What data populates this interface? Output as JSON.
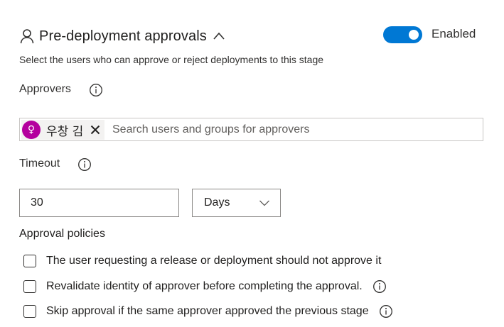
{
  "section": {
    "title": "Pre-deployment approvals",
    "toggle_label": "Enabled",
    "toggle_on": true,
    "description": "Select the users who can approve or reject deployments to this stage"
  },
  "approvers": {
    "label": "Approvers",
    "chips": [
      {
        "name": "우창 김",
        "avatar_glyph": "♀",
        "avatar_color": "#b4009e"
      }
    ],
    "placeholder": "Search users and groups for approvers"
  },
  "timeout": {
    "label": "Timeout",
    "value": "30",
    "unit": "Days"
  },
  "policies": {
    "title": "Approval policies",
    "items": [
      {
        "label": "The user requesting a release or deployment should not approve it",
        "checked": false,
        "has_info": false
      },
      {
        "label": "Revalidate identity of approver before completing the approval.",
        "checked": false,
        "has_info": true
      },
      {
        "label": "Skip approval if the same approver approved the previous stage",
        "checked": false,
        "has_info": true
      }
    ]
  },
  "colors": {
    "accent": "#0078d4",
    "avatar": "#b4009e",
    "text": "#201f1e",
    "border": "#8a8886"
  }
}
